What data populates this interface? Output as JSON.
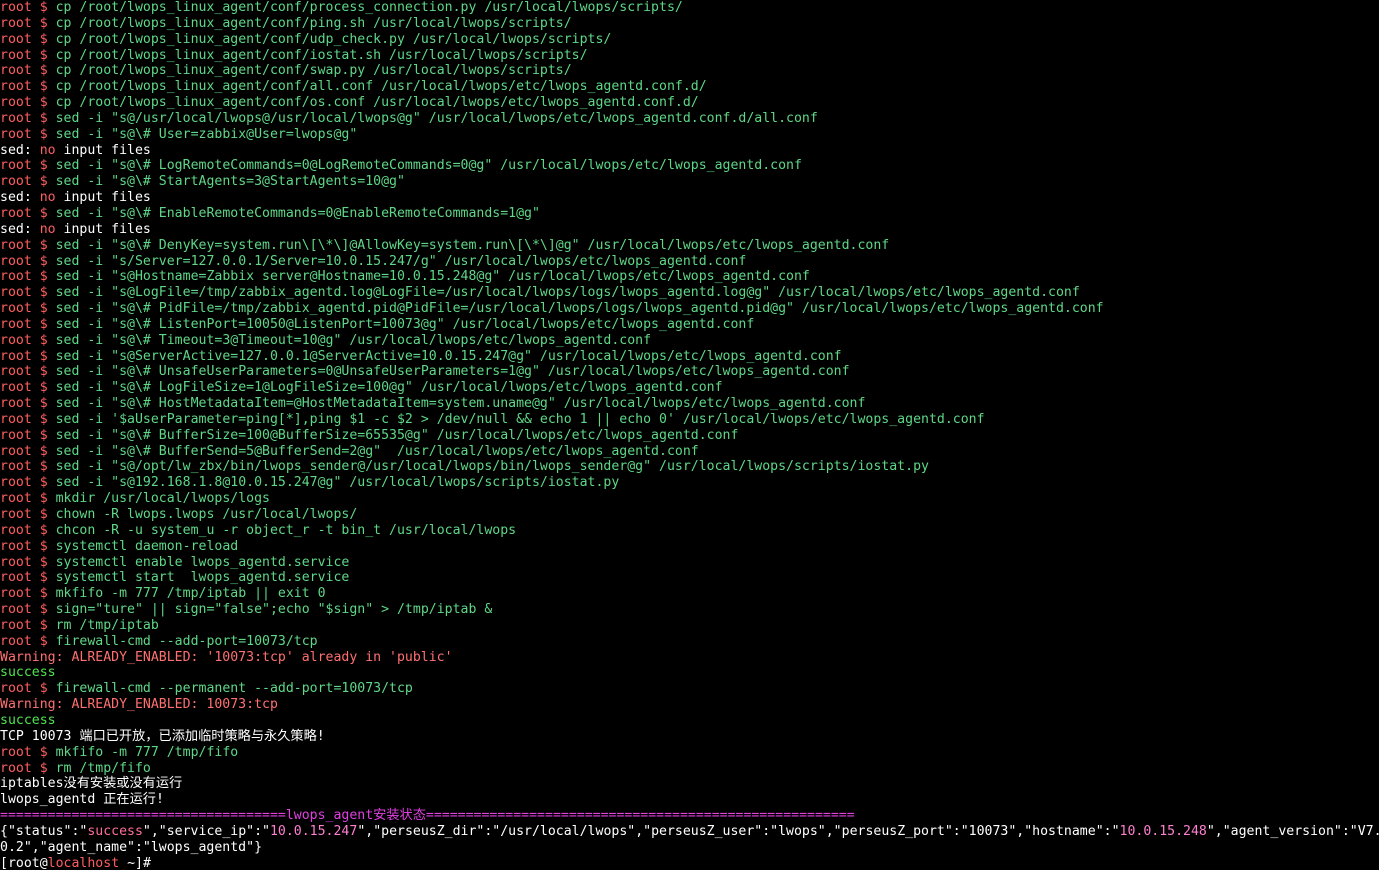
{
  "terminal": {
    "prompt": "root $",
    "lines": [
      {
        "kind": "cmd",
        "text": "cp /root/lwops_linux_agent/conf/process_connection.py /usr/local/lwops/scripts/"
      },
      {
        "kind": "cmd",
        "text": "cp /root/lwops_linux_agent/conf/ping.sh /usr/local/lwops/scripts/"
      },
      {
        "kind": "cmd",
        "text": "cp /root/lwops_linux_agent/conf/udp_check.py /usr/local/lwops/scripts/"
      },
      {
        "kind": "cmd",
        "text": "cp /root/lwops_linux_agent/conf/iostat.sh /usr/local/lwops/scripts/"
      },
      {
        "kind": "cmd",
        "text": "cp /root/lwops_linux_agent/conf/swap.py /usr/local/lwops/scripts/"
      },
      {
        "kind": "cmd",
        "text": "cp /root/lwops_linux_agent/conf/all.conf /usr/local/lwops/etc/lwops_agentd.conf.d/"
      },
      {
        "kind": "cmd",
        "text": "cp /root/lwops_linux_agent/conf/os.conf /usr/local/lwops/etc/lwops_agentd.conf.d/"
      },
      {
        "kind": "cmd",
        "text": "sed -i \"s@/usr/local/lwops@/usr/local/lwops@g\" /usr/local/lwops/etc/lwops_agentd.conf.d/all.conf"
      },
      {
        "kind": "cmd",
        "text": "sed -i \"s@\\# User=zabbix@User=lwops@g\""
      },
      {
        "kind": "sed",
        "prefix": "sed: ",
        "no": "no",
        "rest": " input files"
      },
      {
        "kind": "cmd",
        "text": "sed -i \"s@\\# LogRemoteCommands=0@LogRemoteCommands=0@g\" /usr/local/lwops/etc/lwops_agentd.conf"
      },
      {
        "kind": "cmd",
        "text": "sed -i \"s@\\# StartAgents=3@StartAgents=10@g\""
      },
      {
        "kind": "sed",
        "prefix": "sed: ",
        "no": "no",
        "rest": " input files"
      },
      {
        "kind": "cmd",
        "text": "sed -i \"s@\\# EnableRemoteCommands=0@EnableRemoteCommands=1@g\""
      },
      {
        "kind": "sed",
        "prefix": "sed: ",
        "no": "no",
        "rest": " input files"
      },
      {
        "kind": "cmd",
        "text": "sed -i \"s@\\# DenyKey=system.run\\[\\*\\]@AllowKey=system.run\\[\\*\\]@g\" /usr/local/lwops/etc/lwops_agentd.conf"
      },
      {
        "kind": "cmd",
        "text": "sed -i \"s/Server=127.0.0.1/Server=10.0.15.247/g\" /usr/local/lwops/etc/lwops_agentd.conf"
      },
      {
        "kind": "cmd",
        "text": "sed -i \"s@Hostname=Zabbix server@Hostname=10.0.15.248@g\" /usr/local/lwops/etc/lwops_agentd.conf"
      },
      {
        "kind": "cmd",
        "text": "sed -i \"s@LogFile=/tmp/zabbix_agentd.log@LogFile=/usr/local/lwops/logs/lwops_agentd.log@g\" /usr/local/lwops/etc/lwops_agentd.conf"
      },
      {
        "kind": "cmd",
        "text": "sed -i \"s@\\# PidFile=/tmp/zabbix_agentd.pid@PidFile=/usr/local/lwops/logs/lwops_agentd.pid@g\" /usr/local/lwops/etc/lwops_agentd.conf"
      },
      {
        "kind": "cmd",
        "text": "sed -i \"s@\\# ListenPort=10050@ListenPort=10073@g\" /usr/local/lwops/etc/lwops_agentd.conf"
      },
      {
        "kind": "cmd",
        "text": "sed -i \"s@\\# Timeout=3@Timeout=10@g\" /usr/local/lwops/etc/lwops_agentd.conf"
      },
      {
        "kind": "cmd",
        "text": "sed -i \"s@ServerActive=127.0.0.1@ServerActive=10.0.15.247@g\" /usr/local/lwops/etc/lwops_agentd.conf"
      },
      {
        "kind": "cmd",
        "text": "sed -i \"s@\\# UnsafeUserParameters=0@UnsafeUserParameters=1@g\" /usr/local/lwops/etc/lwops_agentd.conf"
      },
      {
        "kind": "cmd",
        "text": "sed -i \"s@\\# LogFileSize=1@LogFileSize=100@g\" /usr/local/lwops/etc/lwops_agentd.conf"
      },
      {
        "kind": "cmd",
        "text": "sed -i \"s@\\# HostMetadataItem=@HostMetadataItem=system.uname@g\" /usr/local/lwops/etc/lwops_agentd.conf"
      },
      {
        "kind": "cmd",
        "text": "sed -i '$aUserParameter=ping[*],ping $1 -c $2 > /dev/null && echo 1 || echo 0' /usr/local/lwops/etc/lwops_agentd.conf"
      },
      {
        "kind": "cmd",
        "text": "sed -i \"s@\\# BufferSize=100@BufferSize=65535@g\" /usr/local/lwops/etc/lwops_agentd.conf"
      },
      {
        "kind": "cmd",
        "text": "sed -i \"s@\\# BufferSend=5@BufferSend=2@g\"  /usr/local/lwops/etc/lwops_agentd.conf"
      },
      {
        "kind": "cmd",
        "text": "sed -i \"s@/opt/lw_zbx/bin/lwops_sender@/usr/local/lwops/bin/lwops_sender@g\" /usr/local/lwops/scripts/iostat.py"
      },
      {
        "kind": "cmd",
        "text": "sed -i \"s@192.168.1.8@10.0.15.247@g\" /usr/local/lwops/scripts/iostat.py"
      },
      {
        "kind": "cmd",
        "text": "mkdir /usr/local/lwops/logs"
      },
      {
        "kind": "cmd",
        "text": "chown -R lwops.lwops /usr/local/lwops/"
      },
      {
        "kind": "cmd",
        "text": "chcon -R -u system_u -r object_r -t bin_t /usr/local/lwops"
      },
      {
        "kind": "cmd",
        "text": "systemctl daemon-reload"
      },
      {
        "kind": "cmd",
        "text": "systemctl enable lwops_agentd.service"
      },
      {
        "kind": "cmd",
        "text": "systemctl start  lwops_agentd.service"
      },
      {
        "kind": "cmd",
        "text": "mkfifo -m 777 /tmp/iptab || exit 0"
      },
      {
        "kind": "cmd",
        "text": "sign=\"ture\" || sign=\"false\";echo \"$sign\" > /tmp/iptab &"
      },
      {
        "kind": "cmd",
        "text": "rm /tmp/iptab"
      },
      {
        "kind": "cmd",
        "text": "firewall-cmd --add-port=10073/tcp"
      },
      {
        "kind": "warn",
        "text": "Warning: ALREADY_ENABLED: '10073:tcp' already in 'public'"
      },
      {
        "kind": "succ",
        "text": "success"
      },
      {
        "kind": "cmd",
        "text": "firewall-cmd --permanent --add-port=10073/tcp"
      },
      {
        "kind": "warn",
        "text": "Warning: ALREADY_ENABLED: 10073:tcp"
      },
      {
        "kind": "succ",
        "text": "success"
      },
      {
        "kind": "plain",
        "text": "TCP 10073 端口已开放，已添加临时策略与永久策略!"
      },
      {
        "kind": "cmd",
        "text": "mkfifo -m 777 /tmp/fifo"
      },
      {
        "kind": "cmd",
        "text": "rm /tmp/fifo"
      },
      {
        "kind": "plain",
        "text": "iptables没有安装或没有运行"
      },
      {
        "kind": "plain",
        "text": "lwops_agentd 正在运行!"
      },
      {
        "kind": "banner",
        "text": "====================================lwops_agent安装状态======================================================"
      }
    ],
    "json_output": {
      "line1_parts": [
        {
          "c": "jk",
          "t": "{\"status\":\""
        },
        {
          "c": "jv-red",
          "t": "success"
        },
        {
          "c": "jk",
          "t": "\",\"service_ip\":\""
        },
        {
          "c": "jv-mag",
          "t": "10.0.15.247"
        },
        {
          "c": "jk",
          "t": "\",\"perseusZ_dir\":\"/usr/local/lwops\",\"perseusZ_user\":\"lwops\",\"perseusZ_port\":\"10073\",\"hostname\":\""
        },
        {
          "c": "jv-mag",
          "t": "10.0.15.248"
        },
        {
          "c": "jk",
          "t": "\",\"agent_version\":\"V7."
        }
      ],
      "line2": "0.2\",\"agent_name\":\"lwops_agentd\"}"
    },
    "final_prompt": {
      "open": "[",
      "user": "root",
      "at": "@",
      "host": "localhost",
      "rest": " ~]#"
    }
  }
}
